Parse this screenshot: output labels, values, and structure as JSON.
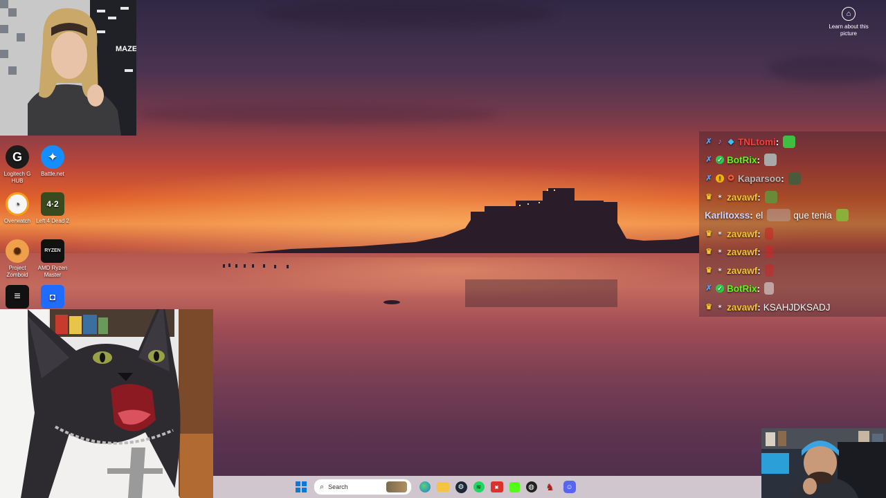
{
  "desktop": {
    "icons": [
      {
        "label": "Logitech G HUB",
        "icon": "logitech-g-icon"
      },
      {
        "label": "Battle.net",
        "icon": "battlenet-icon"
      },
      {
        "label": "Overwatch",
        "icon": "overwatch-icon"
      },
      {
        "label": "Left 4 Dead 2",
        "icon": "left4dead2-icon"
      },
      {
        "label": "Project Zomboid",
        "icon": "zomboid-icon"
      },
      {
        "label": "AMD Ryzen Master",
        "icon": "ryzen-icon"
      },
      {
        "label": "",
        "icon": "epic-icon"
      },
      {
        "label": "",
        "icon": "roblox-icon"
      }
    ],
    "learn_about": "Learn about this picture"
  },
  "webcam_top": {
    "sign_text": "MAZEL"
  },
  "chat": {
    "messages": [
      {
        "user": "TNLtomi",
        "color": "#ff3c3c",
        "text": ""
      },
      {
        "user": "BotRix",
        "color": "#53fc18",
        "text": ""
      },
      {
        "user": "Kaparsoo",
        "color": "#b8b8b8",
        "text": ""
      },
      {
        "user": "zavawf",
        "color": "#f7c52e",
        "text": ""
      },
      {
        "user": "Karlitoxss",
        "color": "#cfd7ff",
        "text": "el",
        "text2": "que tenia"
      },
      {
        "user": "zavawf",
        "color": "#f7c52e",
        "text": ""
      },
      {
        "user": "zavawf",
        "color": "#f7c52e",
        "text": ""
      },
      {
        "user": "zavawf",
        "color": "#f7c52e",
        "text": ""
      },
      {
        "user": "BotRix",
        "color": "#53fc18",
        "text": ""
      },
      {
        "user": "zavawf",
        "color": "#f7c52e",
        "text": "KSAHJDKSADJ"
      }
    ]
  },
  "taskbar": {
    "search_placeholder": "Search",
    "icons": [
      "windows-start-icon",
      "search-icon",
      "edge-icon",
      "file-explorer-icon",
      "steam-icon",
      "spotify-icon",
      "app-icon",
      "kick-icon",
      "obs-icon",
      "game-icon",
      "discord-icon"
    ]
  },
  "colors": {
    "chat_mod": "#4fa3ff",
    "sky_top": "#2f2845",
    "sunset": "#f08d45"
  }
}
